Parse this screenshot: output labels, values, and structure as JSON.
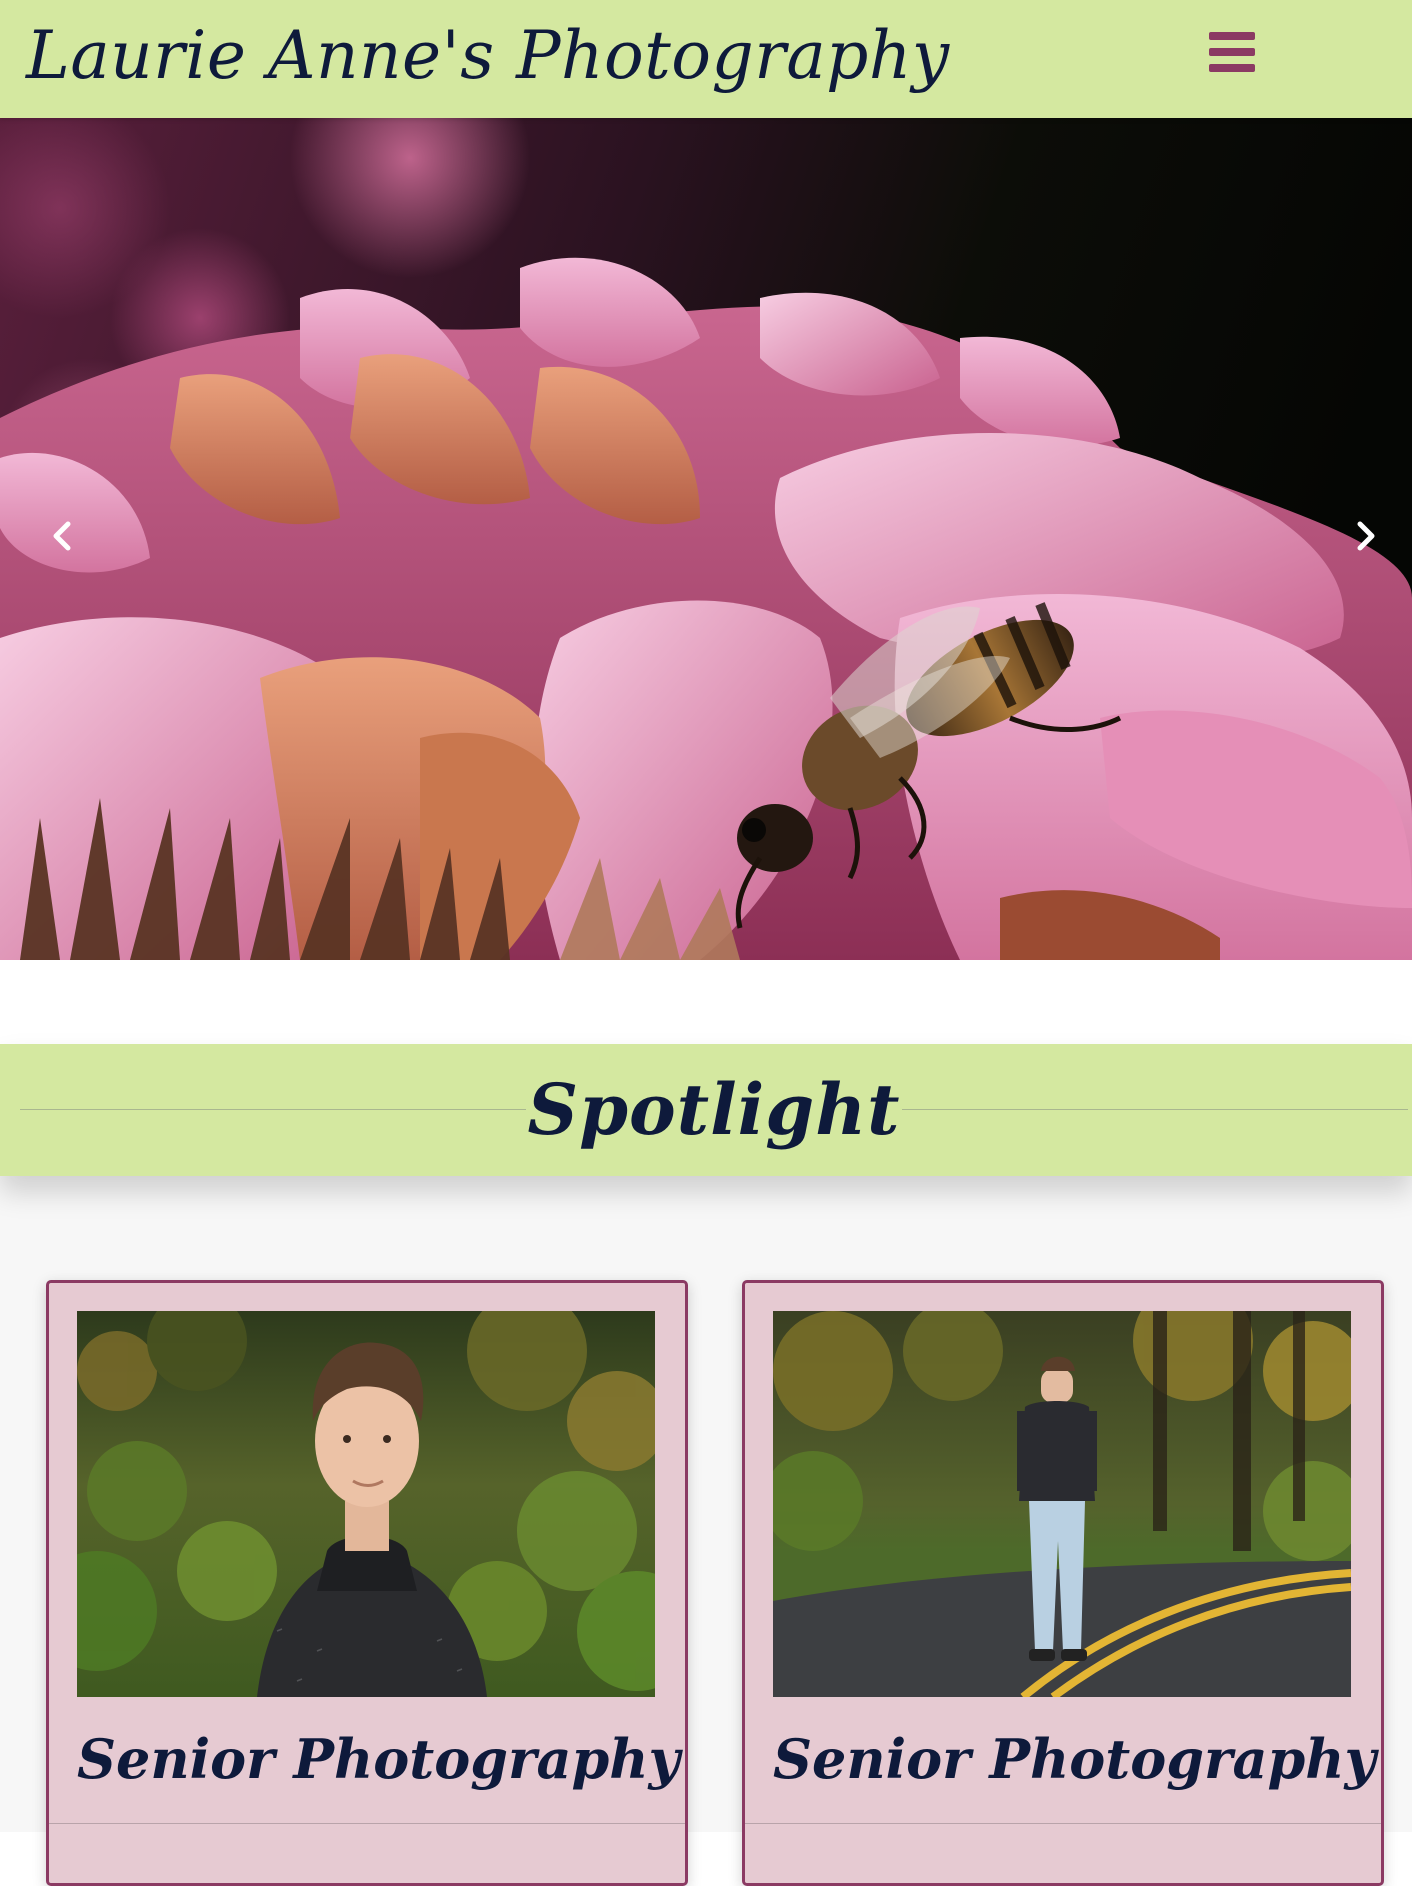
{
  "header": {
    "site_title": "Laurie Anne's Photography",
    "background_color": "#d4e8a0",
    "menu_icon": "hamburger-menu-icon",
    "menu_icon_color": "#8b3a63"
  },
  "hero": {
    "subject": "bee on pink zinnia flower",
    "prev_icon": "chevron-left-icon",
    "next_icon": "chevron-right-icon"
  },
  "spotlight": {
    "heading": "Spotlight"
  },
  "cards": [
    {
      "title": "Senior Photography",
      "photo_subject": "teen in dark hoodie, head-and-shoulders portrait, autumn foliage"
    },
    {
      "title": "Senior Photography",
      "photo_subject": "teen standing on curved road with yellow lines, autumn forest"
    }
  ],
  "colors": {
    "accent_green": "#d4e8a0",
    "accent_plum": "#8b3a63",
    "card_background": "#e6cad2",
    "text_navy": "#0e1a3b"
  }
}
